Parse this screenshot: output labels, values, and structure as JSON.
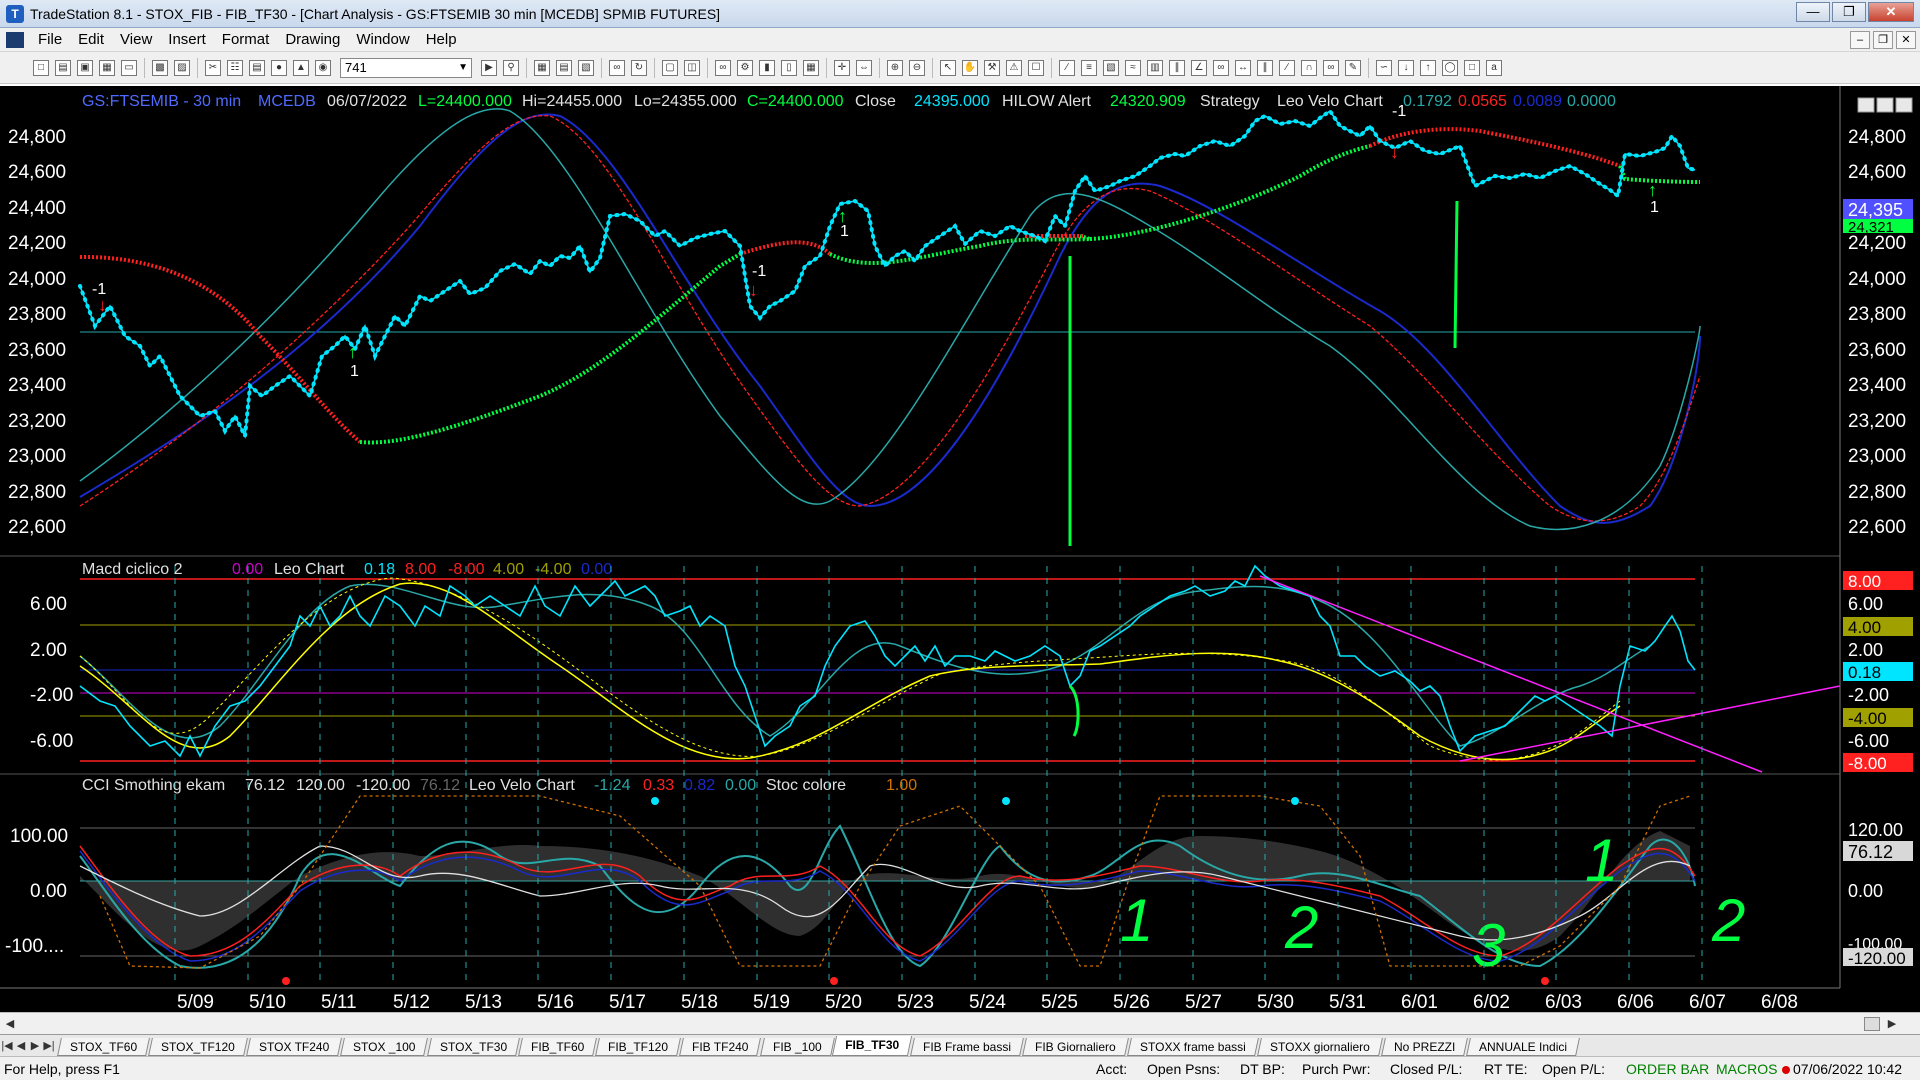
{
  "window": {
    "title": "TradeStation 8.1 - STOX_FIB - FIB_TF30 - [Chart Analysis - GS:FTSEMIB  30 min  [MCEDB] SPMIB FUTURES]"
  },
  "menu": [
    "File",
    "Edit",
    "View",
    "Insert",
    "Format",
    "Drawing",
    "Window",
    "Help"
  ],
  "toolbar": {
    "bar_count": "741"
  },
  "price_header": {
    "symbol": "GS:FTSEMIB - 30 min",
    "source": "MCEDB",
    "date": "06/07/2022",
    "last": "L=24400.000",
    "high": "Hi=24455.000",
    "low": "Lo=24355.000",
    "close_val": "C=24400.000",
    "close_label": "Close",
    "close_num": "24395.000",
    "hilow_label": "HILOW Alert",
    "hilow_val": "24320.909",
    "strategy_label": "Strategy",
    "leo_label": "Leo Velo Chart",
    "leo_v1": "0.1792",
    "leo_v2": "0.0565",
    "leo_v3": "0.0089",
    "leo_v4": "0.0000"
  },
  "price_axis": [
    "24,800",
    "24,600",
    "24,400",
    "24,200",
    "24,000",
    "23,800",
    "23,600",
    "23,400",
    "23,200",
    "23,000",
    "22,800",
    "22,600"
  ],
  "price_tags": {
    "last": "24,395",
    "hilow": "24,321"
  },
  "macd_header": {
    "name": "Macd ciclico 2",
    "v0": "0.00",
    "leo": "Leo Chart",
    "v1": "0.18",
    "v2": "8.00",
    "v3": "-8.00",
    "v4": "4.00",
    "v5": "-4.00",
    "v6": "0.00"
  },
  "macd_axis": [
    "6.00",
    "2.00",
    "-2.00",
    "-6.00"
  ],
  "macd_tags": [
    "8.00",
    "6.00",
    "4.00",
    "2.00",
    "0.18",
    "-2.00",
    "-4.00",
    "-6.00",
    "-8.00"
  ],
  "cci_header": {
    "name": "CCI Smothing ekam",
    "v1": "76.12",
    "v2": "120.00",
    "v3": "-120.00",
    "v4": "76.12",
    "leo": "Leo Velo Chart",
    "l1": "-1.24",
    "l2": "0.33",
    "l3": "0.82",
    "l4": "0.00",
    "stoc": "Stoc colore",
    "s1": "1.00"
  },
  "cci_axis": [
    "100.00",
    "0.00",
    "-100...."
  ],
  "cci_tags": [
    "120.00",
    "76.12",
    "0.00",
    "-100.00",
    "-120.00"
  ],
  "dates": [
    "5/09",
    "5/10",
    "5/11",
    "5/12",
    "5/13",
    "5/16",
    "5/17",
    "5/18",
    "5/19",
    "5/20",
    "5/23",
    "5/24",
    "5/25",
    "5/26",
    "5/27",
    "5/30",
    "5/31",
    "6/01",
    "6/02",
    "6/03",
    "6/06",
    "6/07",
    "6/08"
  ],
  "signals": {
    "sell1": "-1",
    "buy1": "1",
    "sell2": "-1",
    "buy2": "1",
    "sell3": "-1",
    "buy3": "1"
  },
  "annotations": [
    "1",
    "2",
    "3",
    "1",
    "2"
  ],
  "tabs": [
    "STOX_TF60",
    "STOX_TF120",
    "STOX TF240",
    "STOX _100",
    "STOX_TF30",
    "FIB_TF60",
    "FIB_TF120",
    "FIB TF240",
    "FIB _100",
    "FIB_TF30",
    "FIB Frame bassi",
    "FIB Giornaliero",
    "STOXX frame bassi",
    "STOXX giornaliero",
    "No PREZZI",
    "ANNUALE Indici"
  ],
  "active_tab": "FIB_TF30",
  "status": {
    "help": "For Help, press F1",
    "acct": "Acct:",
    "open_psns": "Open Psns:",
    "dt_bp": "DT BP:",
    "purch_pwr": "Purch Pwr:",
    "closed_pl": "Closed P/L:",
    "rt_te": "RT TE:",
    "open_pl": "Open P/L:",
    "order_bar": "ORDER BAR",
    "macros": "MACROS",
    "datetime": "07/06/2022 10:42"
  },
  "colors": {
    "bg": "#000000",
    "price_dots": "#00e5ff",
    "ma_red": "#ff2020",
    "ma_green": "#00ff40",
    "blue": "#1a2acc",
    "teal": "#2aa8a8",
    "yellow": "#ffff00",
    "magenta": "#ff20ff"
  }
}
